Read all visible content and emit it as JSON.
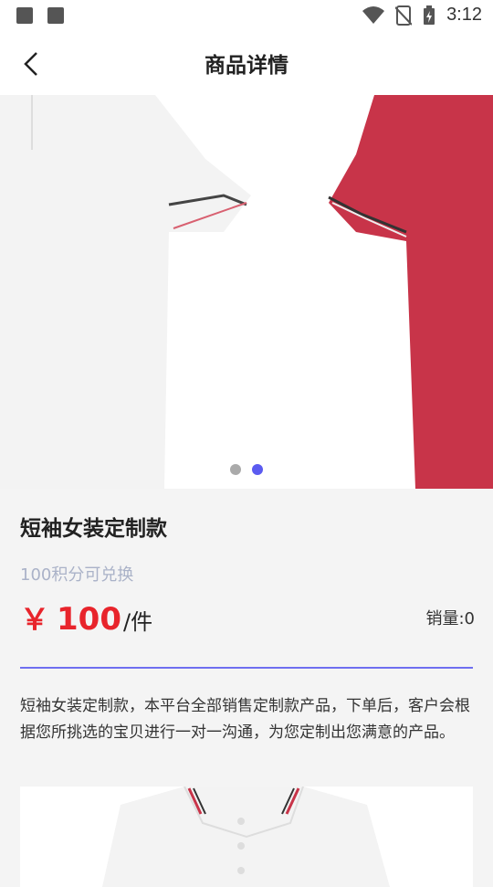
{
  "status_bar": {
    "time": "3:12"
  },
  "header": {
    "title": "商品详情"
  },
  "carousel": {
    "dots": 2,
    "active_index": 1,
    "colors": {
      "left_shirt": "#f3f3f3",
      "right_shirt": "#c83449"
    }
  },
  "product": {
    "name": "短袖女装定制款",
    "points_text": "100积分可兑换",
    "currency": "￥",
    "price": "100",
    "unit": "/件",
    "sales": "销量:0",
    "description": "短袖女装定制款，本平台全部销售定制款产品，下单后，客户会根据您所挑选的宝贝进行一对一沟通，为您定制出您满意的产品。"
  },
  "colors": {
    "accent": "#5b5bf0",
    "price": "#e8242b",
    "points": "#aab2c8"
  }
}
